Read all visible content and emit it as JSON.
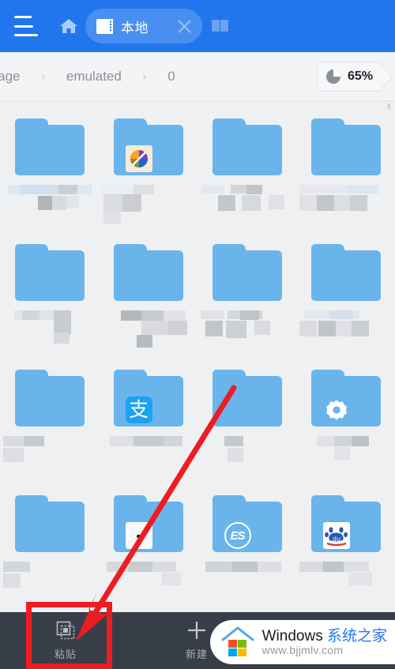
{
  "header": {
    "menu_icon": "hamburger-icon",
    "home_icon": "home-icon",
    "tab": {
      "icon": "sd-card-icon",
      "label": "本地",
      "close_icon": "close-icon"
    },
    "new_tab_icon": "new-tab-icon",
    "bg_color": "#2176ee"
  },
  "breadcrumb": {
    "items": [
      {
        "label": "orage",
        "truncated": true
      },
      {
        "label": "emulated",
        "truncated": false
      },
      {
        "label": "0",
        "truncated": false
      }
    ],
    "separator": "›",
    "storage": {
      "icon": "pie-chart-icon",
      "percent": "65%"
    }
  },
  "grid": {
    "rows": [
      {
        "cells": [
          {
            "type": "folder",
            "badge": null,
            "label_censored": true
          },
          {
            "type": "folder",
            "badge": "rainbow-ball-icon",
            "label_censored": true
          },
          {
            "type": "folder",
            "badge": null,
            "label_censored": true
          },
          {
            "type": "folder",
            "badge": null,
            "label_censored": true
          }
        ]
      },
      {
        "cells": [
          {
            "type": "folder",
            "badge": null,
            "label_censored": true
          },
          {
            "type": "folder",
            "badge": null,
            "label_censored": true
          },
          {
            "type": "folder",
            "badge": null,
            "label_censored": true
          },
          {
            "type": "folder",
            "badge": null,
            "label_censored": true
          }
        ]
      },
      {
        "cells": [
          {
            "type": "folder",
            "badge": null,
            "label_censored": true
          },
          {
            "type": "folder",
            "badge": "alipay-icon",
            "badge_text": "支",
            "label_censored": true
          },
          {
            "type": "folder",
            "badge": null,
            "label_censored": true
          },
          {
            "type": "folder",
            "badge": "gear-icon",
            "label_censored": true
          }
        ]
      },
      {
        "cells": [
          {
            "type": "folder",
            "badge": null,
            "label_censored": true
          },
          {
            "type": "folder",
            "badge": "document-icon",
            "label_censored": true
          },
          {
            "type": "folder",
            "badge": "es-file-explorer-icon",
            "badge_text": "ES",
            "label_censored": true
          },
          {
            "type": "folder",
            "badge": "baidu-icon",
            "badge_text": "du",
            "label_censored": true
          }
        ]
      }
    ],
    "folder_color": "#6ab4ec"
  },
  "bottom_bar": {
    "bg_color": "#383e47",
    "items": [
      {
        "icon": "paste-icon",
        "label": "粘贴",
        "highlighted": true
      },
      {
        "icon": "plus-icon",
        "label": "新建",
        "highlighted": false
      }
    ]
  },
  "annotation": {
    "color": "#ee1c22",
    "shapes": [
      "arrow",
      "highlight-box"
    ],
    "target": "粘贴"
  },
  "watermark": {
    "title_en": "Windows ",
    "title_cn": "系统之家",
    "url": "www.bjjmlv.com",
    "accent": "#2176ee"
  }
}
